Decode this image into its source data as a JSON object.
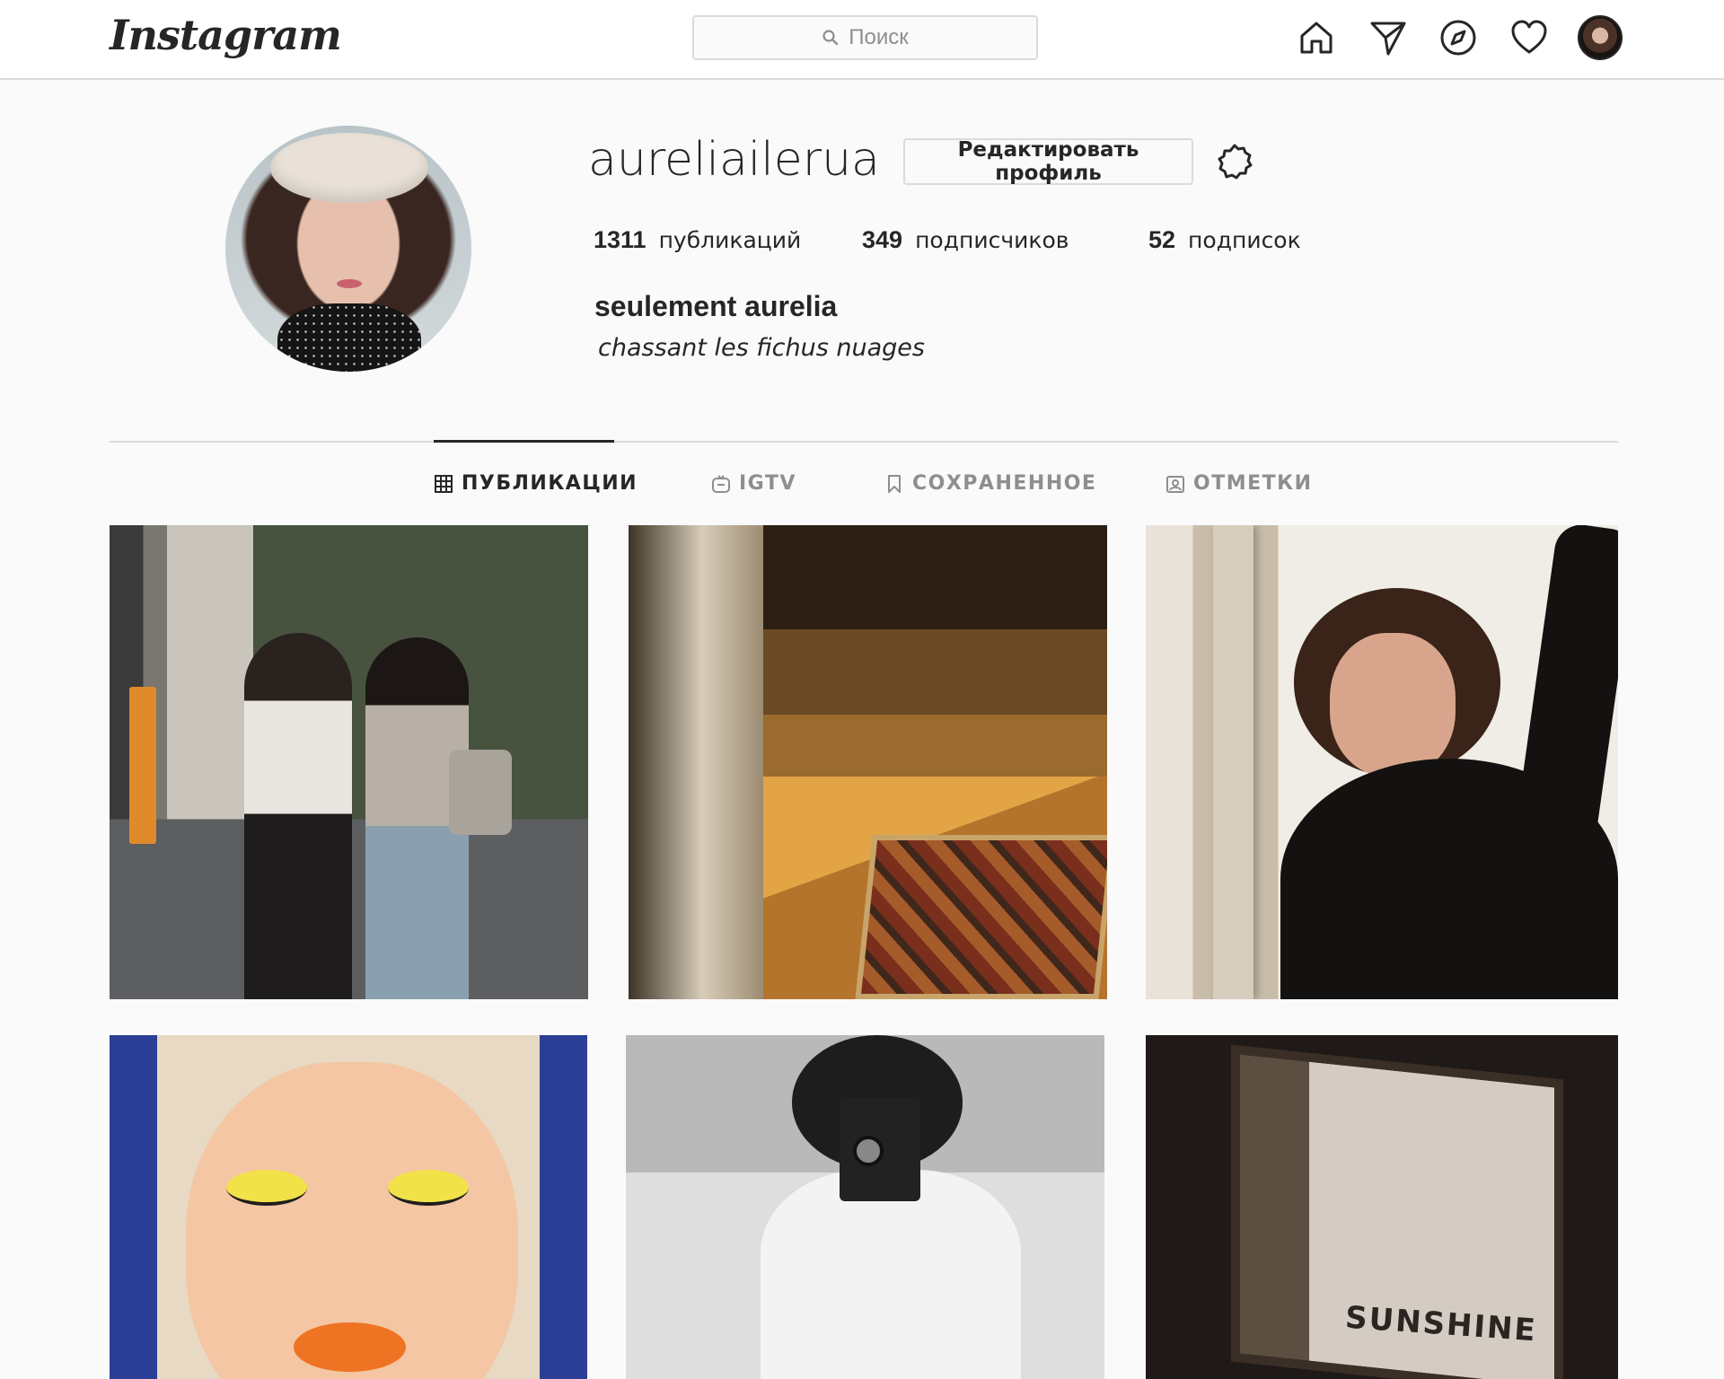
{
  "app": {
    "logo_text": "Instagram"
  },
  "search": {
    "placeholder": "Поиск",
    "icon": "search-icon"
  },
  "nav": {
    "icons": [
      "home-icon",
      "direct-message-icon",
      "explore-compass-icon",
      "activity-heart-icon",
      "profile-avatar"
    ]
  },
  "profile": {
    "username": "aureliailerua",
    "edit_button": "Редактировать профиль",
    "settings_icon": "settings-gear-icon",
    "stats": {
      "posts_count": "1311",
      "posts_label": "публикаций",
      "followers_count": "349",
      "followers_label": "подписчиков",
      "following_count": "52",
      "following_label": "подписок"
    },
    "full_name": "seulement aurelia",
    "bio": "chassant les fichus nuages"
  },
  "tabs": [
    {
      "label": "ПУБЛИКАЦИИ",
      "icon": "grid-icon",
      "active": true
    },
    {
      "label": "IGTV",
      "icon": "igtv-icon",
      "active": false
    },
    {
      "label": "СОХРАНЕННОЕ",
      "icon": "bookmark-icon",
      "active": false
    },
    {
      "label": "ОТМЕТКИ",
      "icon": "tagged-icon",
      "active": false
    }
  ],
  "posts": {
    "post6_text": "SUNSHINE"
  },
  "colors": {
    "text": "#262626",
    "muted": "#8e8e8e",
    "border": "#dbdbdb",
    "background": "#fafafa"
  }
}
